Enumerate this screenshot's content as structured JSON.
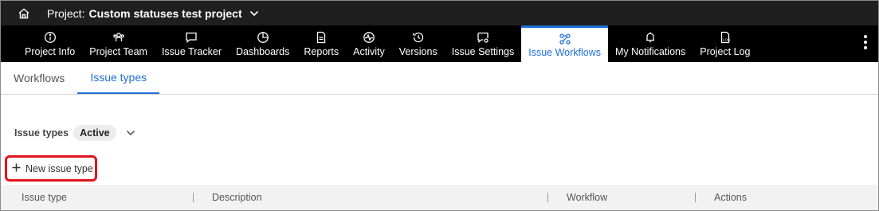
{
  "project_bar": {
    "prefix": "Project:",
    "name": "Custom statuses test project"
  },
  "nav": {
    "items": [
      {
        "label": "Project Info",
        "icon": "info-icon"
      },
      {
        "label": "Project Team",
        "icon": "team-icon"
      },
      {
        "label": "Issue Tracker",
        "icon": "chat-icon"
      },
      {
        "label": "Dashboards",
        "icon": "pie-chart-icon"
      },
      {
        "label": "Reports",
        "icon": "document-icon"
      },
      {
        "label": "Activity",
        "icon": "pulse-icon"
      },
      {
        "label": "Versions",
        "icon": "history-icon"
      },
      {
        "label": "Issue Settings",
        "icon": "settings-chat-icon"
      },
      {
        "label": "Issue Workflows",
        "icon": "workflow-icon",
        "active": true
      },
      {
        "label": "My Notifications",
        "icon": "bell-icon"
      },
      {
        "label": "Project Log",
        "icon": "log-icon"
      }
    ],
    "active_color": "#1e6fd9"
  },
  "subtabs": [
    {
      "label": "Workflows"
    },
    {
      "label": "Issue types",
      "active": true
    }
  ],
  "filter": {
    "label": "Issue types",
    "value": "Active"
  },
  "new_button": {
    "label": "New issue type"
  },
  "table": {
    "columns": [
      "Issue type",
      "Description",
      "Workflow",
      "Actions"
    ]
  },
  "colors": {
    "accent": "#1e6fd9",
    "highlight_border": "#e0141e"
  }
}
